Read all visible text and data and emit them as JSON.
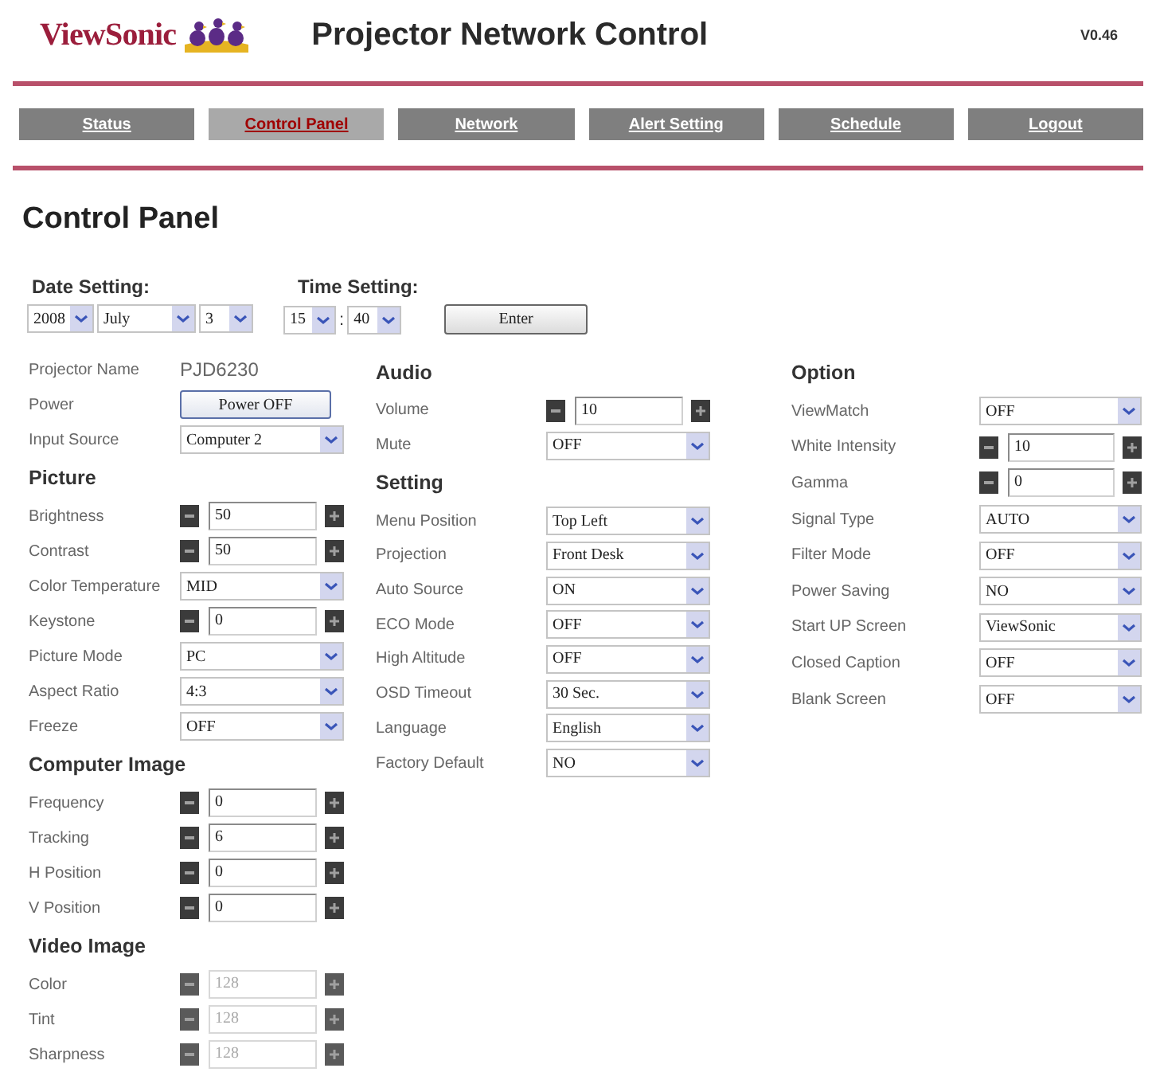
{
  "header": {
    "brand": "ViewSonic",
    "title": "Projector Network Control",
    "version": "V0.46"
  },
  "nav": [
    {
      "label": "Status",
      "selected": false
    },
    {
      "label": "Control Panel",
      "selected": true
    },
    {
      "label": "Network",
      "selected": false
    },
    {
      "label": "Alert Setting",
      "selected": false
    },
    {
      "label": "Schedule",
      "selected": false
    },
    {
      "label": "Logout",
      "selected": false
    }
  ],
  "page_title": "Control Panel",
  "date_setting": {
    "label": "Date Setting:",
    "year": "2008",
    "month": "July",
    "day": "3"
  },
  "time_setting": {
    "label": "Time Setting:",
    "hour": "15",
    "separator": ":",
    "minute": "40",
    "button": "Enter"
  },
  "columns": [
    {
      "sections": [
        {
          "rows": [
            {
              "kind": "text",
              "label": "Projector Name",
              "value": "PJD6230",
              "disabled": false
            },
            {
              "kind": "button",
              "label": "Power",
              "value": "Power OFF",
              "disabled": false
            },
            {
              "kind": "select",
              "label": "Input Source",
              "value": "Computer 2",
              "disabled": false
            }
          ]
        },
        {
          "heading": "Picture",
          "rows": [
            {
              "kind": "stepper",
              "label": "Brightness",
              "value": "50",
              "disabled": false
            },
            {
              "kind": "stepper",
              "label": "Contrast",
              "value": "50",
              "disabled": false
            },
            {
              "kind": "select",
              "label": "Color Temperature",
              "value": "MID",
              "disabled": false
            },
            {
              "kind": "stepper",
              "label": "Keystone",
              "value": "0",
              "disabled": false
            },
            {
              "kind": "select",
              "label": "Picture Mode",
              "value": "PC",
              "disabled": false
            },
            {
              "kind": "select",
              "label": "Aspect Ratio",
              "value": "4:3",
              "disabled": false
            },
            {
              "kind": "select",
              "label": "Freeze",
              "value": "OFF",
              "disabled": false
            }
          ]
        },
        {
          "heading": "Computer Image",
          "rows": [
            {
              "kind": "stepper",
              "label": "Frequency",
              "value": "0",
              "disabled": false
            },
            {
              "kind": "stepper",
              "label": "Tracking",
              "value": "6",
              "disabled": false
            },
            {
              "kind": "stepper",
              "label": "H Position",
              "value": "0",
              "disabled": false
            },
            {
              "kind": "stepper",
              "label": "V Position",
              "value": "0",
              "disabled": false
            }
          ]
        },
        {
          "heading": "Video Image",
          "rows": [
            {
              "kind": "stepper",
              "label": "Color",
              "value": "128",
              "disabled": true
            },
            {
              "kind": "stepper",
              "label": "Tint",
              "value": "128",
              "disabled": true
            },
            {
              "kind": "stepper",
              "label": "Sharpness",
              "value": "128",
              "disabled": true
            }
          ]
        }
      ]
    },
    {
      "sections": [
        {
          "heading": "Audio",
          "rows": [
            {
              "kind": "stepper",
              "label": "Volume",
              "value": "10",
              "disabled": false
            },
            {
              "kind": "select",
              "label": "Mute",
              "value": "OFF",
              "disabled": false
            }
          ]
        },
        {
          "heading": "Setting",
          "rows": [
            {
              "kind": "select",
              "label": "Menu Position",
              "value": "Top Left",
              "disabled": false
            },
            {
              "kind": "select",
              "label": "Projection",
              "value": "Front Desk",
              "disabled": false
            },
            {
              "kind": "select",
              "label": "Auto Source",
              "value": "ON",
              "disabled": false
            },
            {
              "kind": "select",
              "label": "ECO Mode",
              "value": "OFF",
              "disabled": false
            },
            {
              "kind": "select",
              "label": "High Altitude",
              "value": "OFF",
              "disabled": false
            },
            {
              "kind": "select",
              "label": "OSD Timeout",
              "value": "30 Sec.",
              "disabled": false
            },
            {
              "kind": "select",
              "label": "Language",
              "value": "English",
              "disabled": false
            },
            {
              "kind": "select",
              "label": "Factory Default",
              "value": "NO",
              "disabled": false
            }
          ]
        }
      ]
    },
    {
      "sections": [
        {
          "heading": "Option",
          "rows": [
            {
              "kind": "select",
              "label": "ViewMatch",
              "value": "OFF",
              "disabled": false
            },
            {
              "kind": "stepper",
              "label": "White Intensity",
              "value": "10",
              "disabled": false
            },
            {
              "kind": "stepper",
              "label": "Gamma",
              "value": "0",
              "disabled": false
            },
            {
              "kind": "select",
              "label": "Signal Type",
              "value": "AUTO",
              "disabled": false
            },
            {
              "kind": "select",
              "label": "Filter Mode",
              "value": "OFF",
              "disabled": false
            },
            {
              "kind": "select",
              "label": "Power Saving",
              "value": "NO",
              "disabled": false
            },
            {
              "kind": "select",
              "label": "Start UP Screen",
              "value": "ViewSonic",
              "disabled": false
            },
            {
              "kind": "select",
              "label": "Closed Caption",
              "value": "OFF",
              "disabled": false
            },
            {
              "kind": "select",
              "label": "Blank Screen",
              "value": "OFF",
              "disabled": false
            }
          ]
        }
      ]
    }
  ]
}
